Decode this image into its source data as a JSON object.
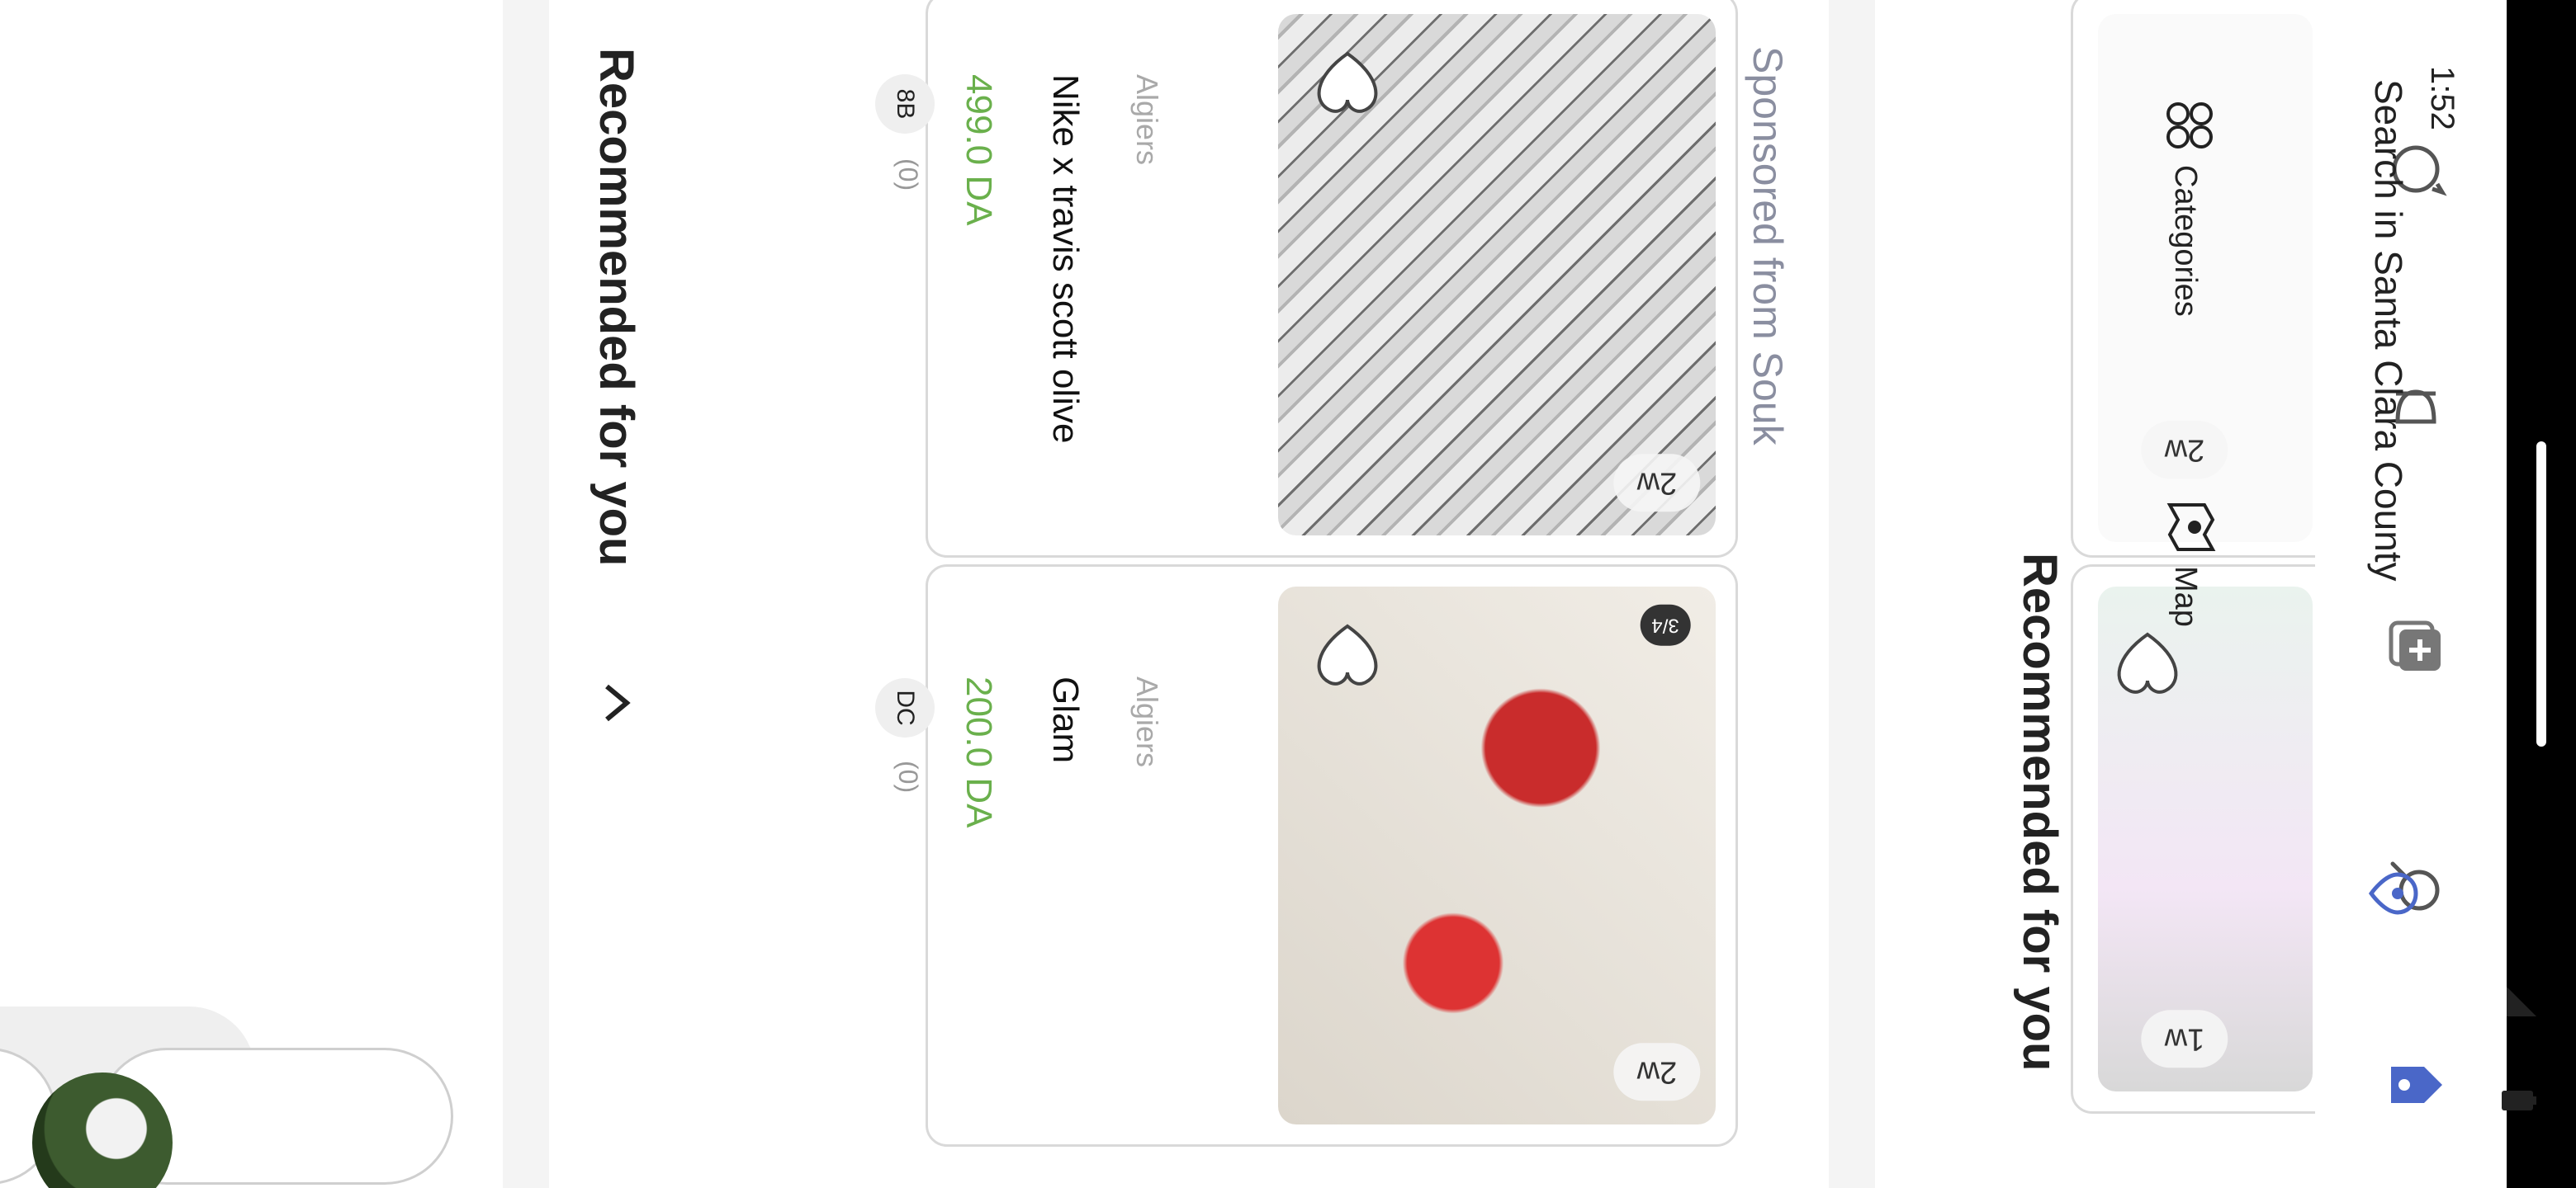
{
  "status_bar": {
    "time": "1:52"
  },
  "search": {
    "placeholder": "Search in Santa Clara County"
  },
  "chips": {
    "categories": "Categories",
    "map": "Map"
  },
  "sponsored": {
    "heading": "Sponsored from Souk",
    "items": [
      {
        "age": "2w",
        "image_counter": "3/4",
        "location": "Algiers",
        "title": "Nike x travis scott olive",
        "price": "499.0 DA",
        "seller_initials": "8B",
        "rating": "(0)"
      },
      {
        "age": "2w",
        "location": "Algiers",
        "title": "Glam",
        "price": "200.0 DA",
        "seller_initials": "DC",
        "rating": "(0)"
      }
    ]
  },
  "recommended": {
    "heading": "Recommended for you",
    "items": [
      {
        "age": "1w"
      },
      {
        "age": "2w"
      }
    ]
  },
  "tabs": [
    {
      "icon": "tag-icon",
      "active": true
    },
    {
      "icon": "search-icon"
    },
    {
      "icon": "add-listing-icon"
    },
    {
      "icon": "bell-icon"
    },
    {
      "icon": "chat-icon"
    }
  ],
  "colors": {
    "accent": "#4a67c8",
    "price": "#6ab04c",
    "sponsor": "#8a8ea0"
  }
}
